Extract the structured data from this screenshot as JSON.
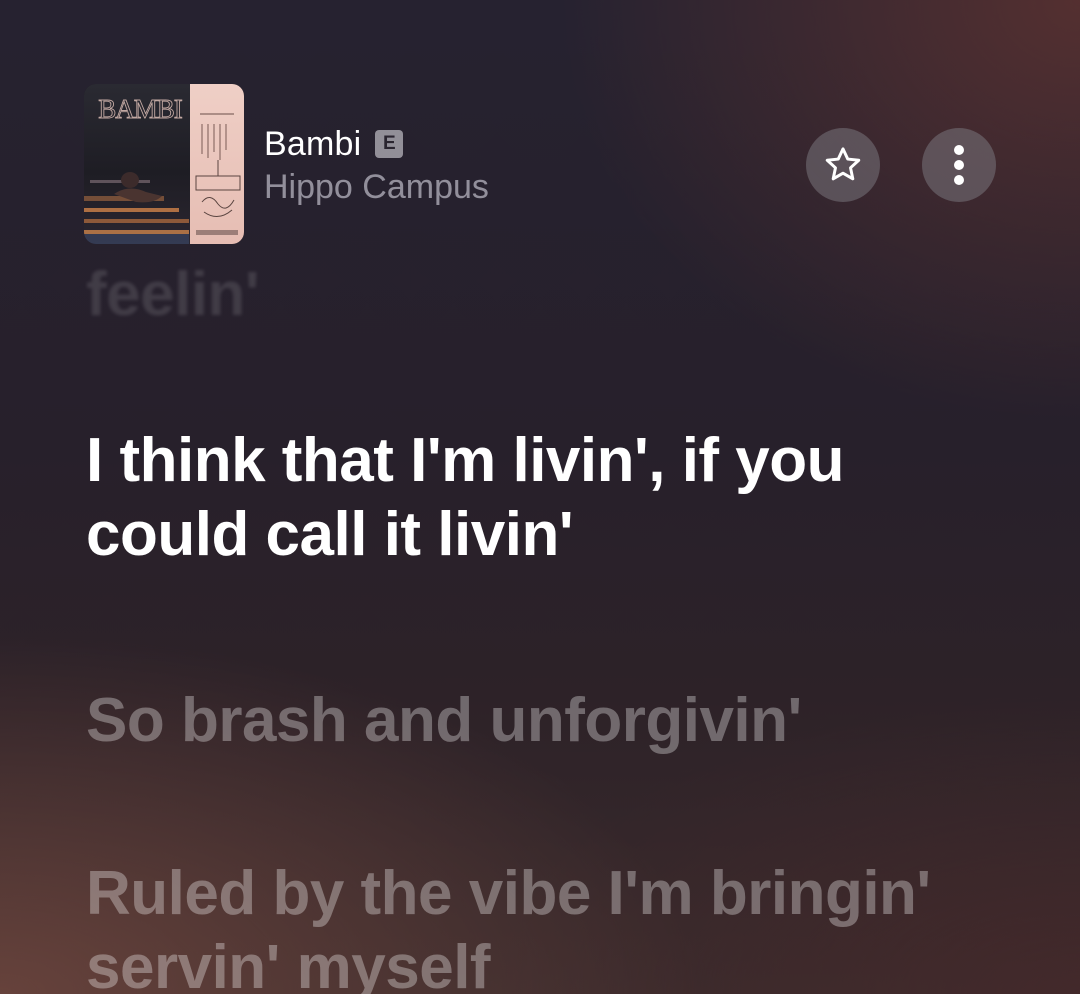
{
  "now_playing": {
    "title": "Bambi",
    "explicit_badge": "E",
    "artist": "Hippo Campus",
    "artwork_text": "BAMBI",
    "icons": {
      "favorite": "star-outline-icon",
      "more": "vertical-ellipsis-icon"
    }
  },
  "lyrics": {
    "previous": "feelin'",
    "current": "I think that I'm livin', if you could call it livin'",
    "next": [
      "So brash and unforgivin'",
      "Ruled by the vibe I'm bringin' servin' myself"
    ]
  },
  "colors": {
    "current_line": "#ffffff",
    "upcoming_line": "rgba(255,255,255,0.32)",
    "past_line": "rgba(255,255,255,0.12)"
  }
}
